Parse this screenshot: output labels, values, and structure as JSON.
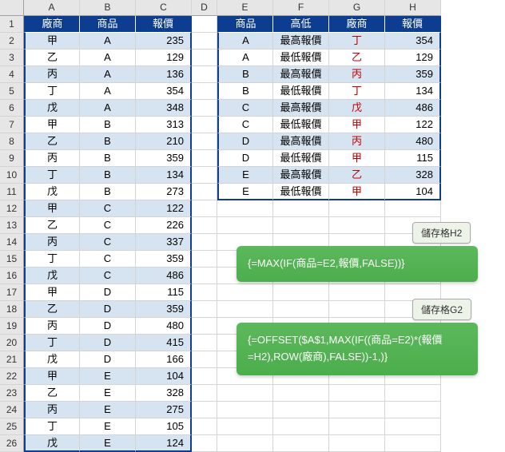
{
  "colheads": [
    "A",
    "B",
    "C",
    "D",
    "E",
    "F",
    "G",
    "H"
  ],
  "leftHeaders": [
    "廠商",
    "商品",
    "報價"
  ],
  "rightHeaders": [
    "商品",
    "高低",
    "廠商",
    "報價"
  ],
  "leftRows": [
    [
      "甲",
      "A",
      "235"
    ],
    [
      "乙",
      "A",
      "129"
    ],
    [
      "丙",
      "A",
      "136"
    ],
    [
      "丁",
      "A",
      "354"
    ],
    [
      "戊",
      "A",
      "348"
    ],
    [
      "甲",
      "B",
      "313"
    ],
    [
      "乙",
      "B",
      "210"
    ],
    [
      "丙",
      "B",
      "359"
    ],
    [
      "丁",
      "B",
      "134"
    ],
    [
      "戊",
      "B",
      "273"
    ],
    [
      "甲",
      "C",
      "122"
    ],
    [
      "乙",
      "C",
      "226"
    ],
    [
      "丙",
      "C",
      "337"
    ],
    [
      "丁",
      "C",
      "359"
    ],
    [
      "戊",
      "C",
      "486"
    ],
    [
      "甲",
      "D",
      "115"
    ],
    [
      "乙",
      "D",
      "359"
    ],
    [
      "丙",
      "D",
      "480"
    ],
    [
      "丁",
      "D",
      "415"
    ],
    [
      "戊",
      "D",
      "166"
    ],
    [
      "甲",
      "E",
      "104"
    ],
    [
      "乙",
      "E",
      "328"
    ],
    [
      "丙",
      "E",
      "275"
    ],
    [
      "丁",
      "E",
      "105"
    ],
    [
      "戊",
      "E",
      "124"
    ]
  ],
  "rightRows": [
    [
      "A",
      "最高報價",
      "丁",
      "354"
    ],
    [
      "A",
      "最低報價",
      "乙",
      "129"
    ],
    [
      "B",
      "最高報價",
      "丙",
      "359"
    ],
    [
      "B",
      "最低報價",
      "丁",
      "134"
    ],
    [
      "C",
      "最高報價",
      "戊",
      "486"
    ],
    [
      "C",
      "最低報價",
      "甲",
      "122"
    ],
    [
      "D",
      "最高報價",
      "丙",
      "480"
    ],
    [
      "D",
      "最低報價",
      "甲",
      "115"
    ],
    [
      "E",
      "最高報價",
      "乙",
      "328"
    ],
    [
      "E",
      "最低報價",
      "甲",
      "104"
    ]
  ],
  "labelH2": "儲存格H2",
  "labelG2": "儲存格G2",
  "formulaH2": "{=MAX(IF(商品=E2,報價,FALSE))}",
  "formulaG2a": "{=OFFSET($A$1,MAX(IF((商品=E2)*(報價",
  "formulaG2b": "=H2),ROW(廠商),FALSE))-1,)}",
  "chart_data": null
}
